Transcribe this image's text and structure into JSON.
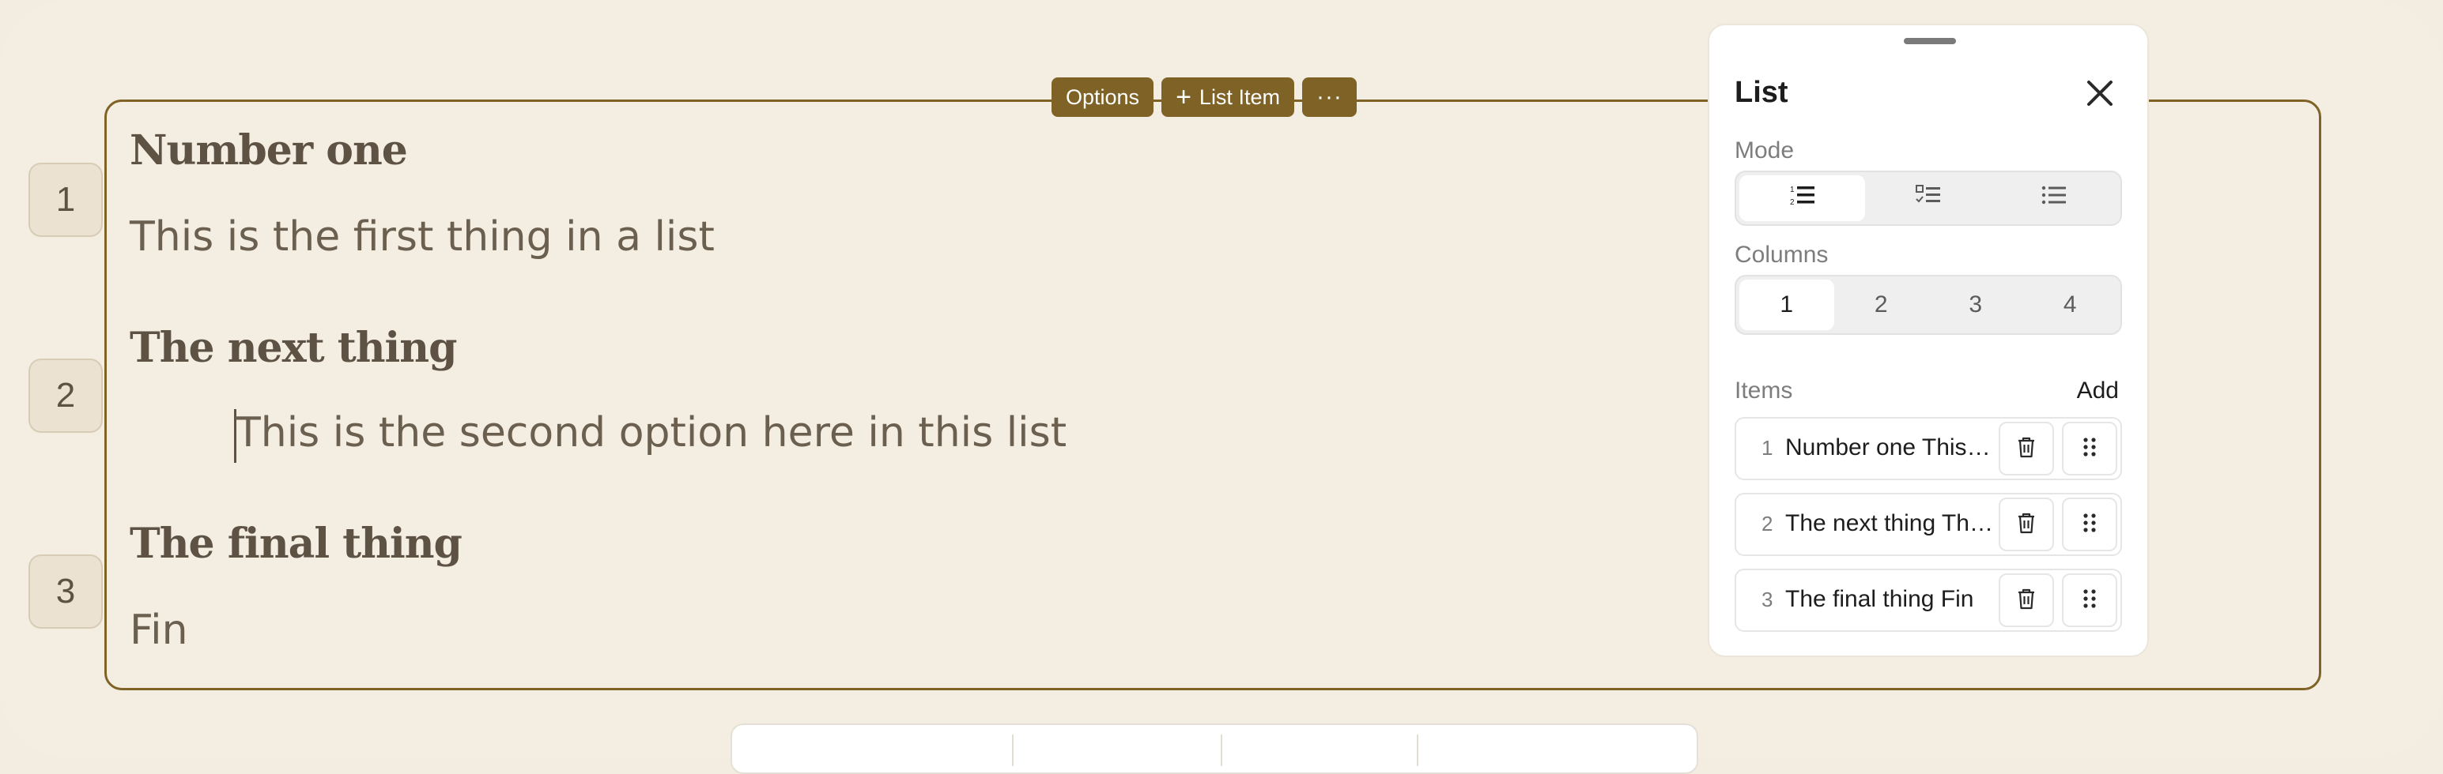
{
  "toolbar": {
    "options_label": "Options",
    "add_item_label": "List Item",
    "more_label": "···"
  },
  "list": {
    "items": [
      {
        "number": "1",
        "title": "Number one",
        "description": "This is the first thing in a list"
      },
      {
        "number": "2",
        "title": "The next thing",
        "description": "This is the second option here in this list"
      },
      {
        "number": "3",
        "title": "The final thing",
        "description": "Fin"
      }
    ]
  },
  "panel": {
    "title": "List",
    "mode_label": "Mode",
    "mode_options": [
      "ordered-list-icon",
      "checklist-icon",
      "bullet-list-icon"
    ],
    "mode_selected": 0,
    "columns_label": "Columns",
    "columns_options": [
      "1",
      "2",
      "3",
      "4"
    ],
    "columns_selected": "1",
    "items_label": "Items",
    "add_label": "Add",
    "rows": [
      {
        "number": "1",
        "text": "Number one This is the first thing in a list"
      },
      {
        "number": "2",
        "text": "The next thing This is the second option here in this list"
      },
      {
        "number": "3",
        "text": "The final thing Fin"
      }
    ]
  },
  "colors": {
    "accent": "#7e6226",
    "background": "#f4eee2",
    "text": "#5d5243"
  }
}
